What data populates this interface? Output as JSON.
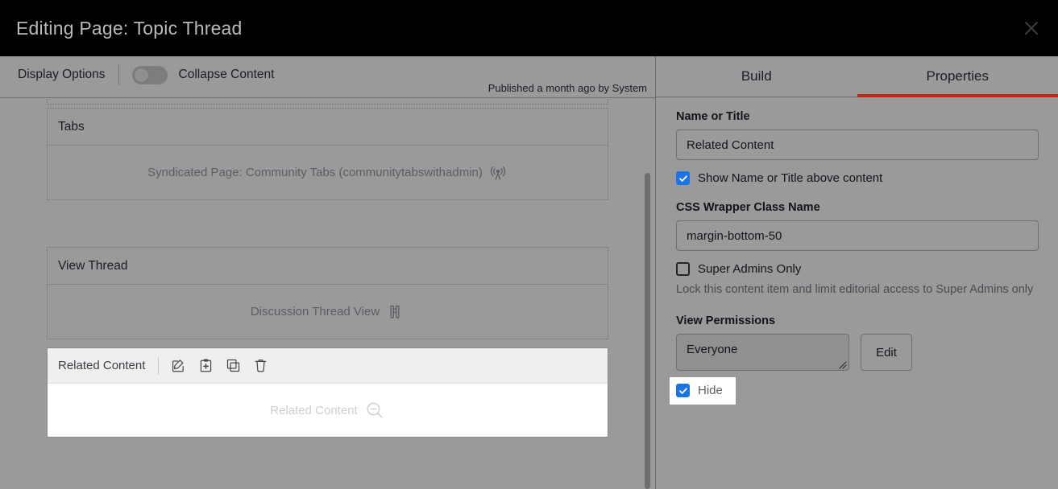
{
  "window": {
    "title": "Editing Page: Topic Thread",
    "close_icon": "close-icon"
  },
  "display_bar": {
    "label": "Display Options",
    "toggle_label": "Collapse Content",
    "toggle_state": "off",
    "published_note": "Published a month ago by System"
  },
  "canvas": {
    "zones": [
      {
        "name": "Tabs",
        "body_text": "Syndicated Page: Community Tabs (communitytabswithadmin)",
        "body_icon": "broadcast-antenna-icon"
      },
      {
        "name": "View Thread",
        "body_text": "Discussion Thread View",
        "body_icon": "binoculars-icon"
      }
    ],
    "related_content_panel": {
      "title": "Related Content",
      "tools": [
        {
          "name": "edit-icon",
          "label": "Edit"
        },
        {
          "name": "clipboard-plus-icon",
          "label": "Add to clipboard"
        },
        {
          "name": "copy-icon",
          "label": "Copy"
        },
        {
          "name": "trash-icon",
          "label": "Delete"
        }
      ],
      "placeholder_text": "Related Content",
      "placeholder_icon": "zoom-out-icon"
    }
  },
  "right_pane": {
    "tabs": [
      {
        "label": "Build",
        "active": false
      },
      {
        "label": "Properties",
        "active": true
      }
    ],
    "accent_color": "#b52d12",
    "checkbox_color": "#1a73e8",
    "fields": {
      "name_or_title": {
        "label": "Name or Title",
        "value": "Related Content",
        "placeholder": "Name or Title"
      },
      "show_name_checkbox": {
        "label": "Show Name or Title above content",
        "checked": true
      },
      "css_wrapper": {
        "label": "CSS Wrapper Class Name",
        "value": "margin-bottom-50",
        "placeholder": "CSS Wrapper Class Name"
      },
      "super_admins_checkbox": {
        "label": "Super Admins Only",
        "checked": false,
        "helper": "Lock this content item and limit editorial access to Super Admins only"
      },
      "view_permissions": {
        "label": "View Permissions",
        "value": "Everyone",
        "edit_button": "Edit",
        "hide_checkbox": {
          "label": "Hide",
          "checked": true
        }
      }
    }
  }
}
